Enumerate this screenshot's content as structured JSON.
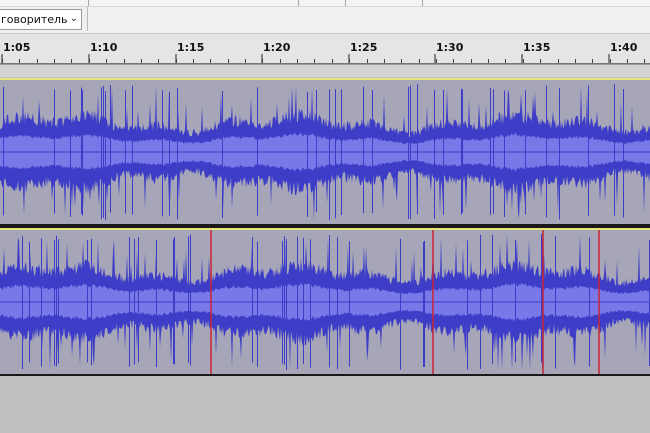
{
  "toolbar": {
    "playback_device": "говоритель"
  },
  "ruler": {
    "ticks": [
      "1:05",
      "1:10",
      "1:15",
      "1:20",
      "1:25",
      "1:30",
      "1:35",
      "1:40"
    ]
  },
  "tracks": [
    {
      "channel": "left"
    },
    {
      "channel": "right"
    }
  ],
  "colors": {
    "waveform": "#3d3dc8",
    "waveform_rms": "#7878e8",
    "track_bg": "#a6a6b8",
    "selection_border": "#e6e67a",
    "clip_boundary": "#cc2233"
  },
  "icons": [
    "chevron-down-icon"
  ]
}
